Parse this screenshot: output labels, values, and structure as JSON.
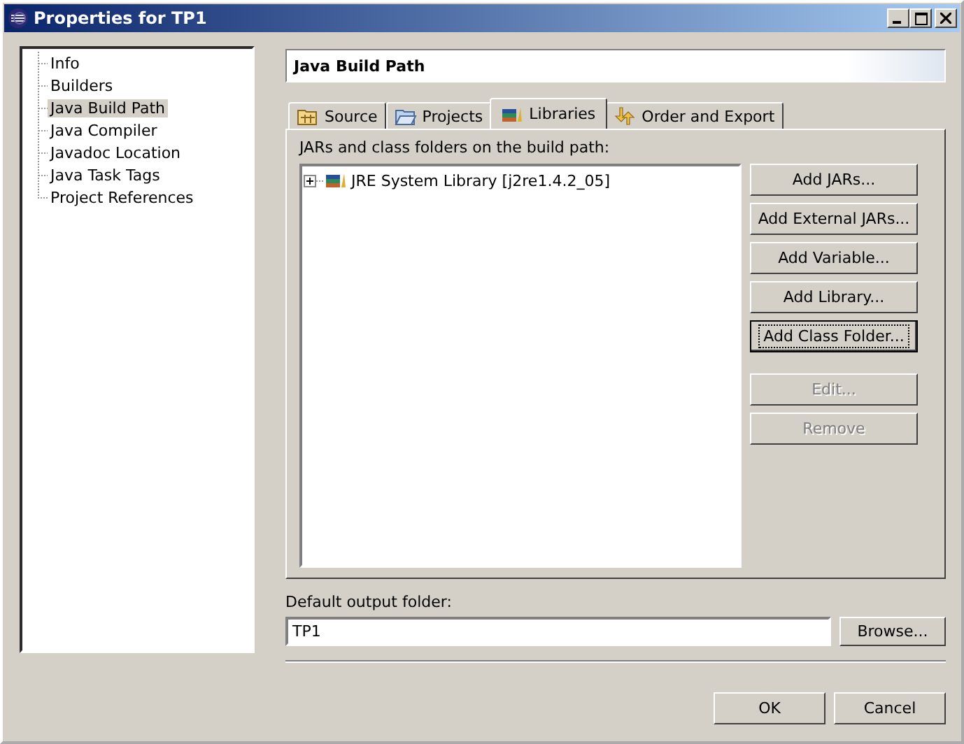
{
  "window": {
    "title": "Properties for TP1"
  },
  "sidebar": {
    "items": [
      {
        "label": "Info",
        "selected": false
      },
      {
        "label": "Builders",
        "selected": false
      },
      {
        "label": "Java Build Path",
        "selected": true
      },
      {
        "label": "Java Compiler",
        "selected": false
      },
      {
        "label": "Javadoc Location",
        "selected": false
      },
      {
        "label": "Java Task Tags",
        "selected": false
      },
      {
        "label": "Project References",
        "selected": false
      }
    ]
  },
  "page_title": "Java Build Path",
  "tabs": [
    {
      "label": "Source",
      "kind": "source",
      "selected": false
    },
    {
      "label": "Projects",
      "kind": "projects",
      "selected": false
    },
    {
      "label": "Libraries",
      "kind": "libraries",
      "selected": true
    },
    {
      "label": "Order and Export",
      "kind": "order",
      "selected": false
    }
  ],
  "list_label": "JARs and class folders on the build path:",
  "libraries": [
    {
      "label": "JRE System Library [j2re1.4.2_05]",
      "expanded": false
    }
  ],
  "buttons": [
    {
      "label": "Add JARs...",
      "disabled": false,
      "focused": false
    },
    {
      "label": "Add External JARs...",
      "disabled": false,
      "focused": false
    },
    {
      "label": "Add Variable...",
      "disabled": false,
      "focused": false
    },
    {
      "label": "Add Library...",
      "disabled": false,
      "focused": false
    },
    {
      "label": "Add Class Folder...",
      "disabled": false,
      "focused": true
    },
    {
      "label": "Edit...",
      "disabled": true,
      "focused": false
    },
    {
      "label": "Remove",
      "disabled": true,
      "focused": false
    }
  ],
  "output": {
    "label": "Default output folder:",
    "value": "TP1",
    "browse": "Browse..."
  },
  "dialog_buttons": [
    "OK",
    "Cancel"
  ]
}
